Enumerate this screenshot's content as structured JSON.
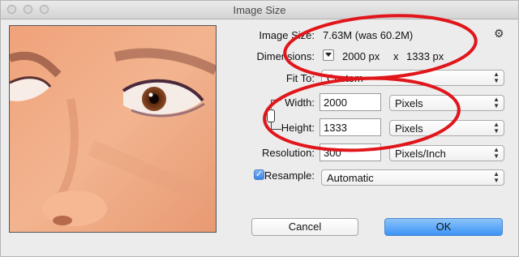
{
  "window": {
    "title": "Image Size"
  },
  "info": {
    "image_size_label": "Image Size:",
    "image_size_value": "7.63M (was 60.2M)",
    "dimensions_label": "Dimensions:",
    "dim_width": "2000 px",
    "dim_x": "x",
    "dim_height": "1333 px"
  },
  "fit_to": {
    "label": "Fit To:",
    "value": "Custom"
  },
  "width": {
    "label": "Width:",
    "value": "2000",
    "unit": "Pixels"
  },
  "height": {
    "label": "Height:",
    "value": "1333",
    "unit": "Pixels"
  },
  "resolution": {
    "label": "Resolution:",
    "value": "300",
    "unit": "Pixels/Inch"
  },
  "resample": {
    "label": "Resample:",
    "checked": true,
    "value": "Automatic"
  },
  "buttons": {
    "cancel": "Cancel",
    "ok": "OK"
  },
  "icons": {
    "gear": "gear-icon",
    "chain": "chain-link-icon",
    "dimensions_menu": "triangle-down-icon"
  },
  "colors": {
    "annotation": "#e0161b",
    "ok_button": "#3c94f6"
  }
}
